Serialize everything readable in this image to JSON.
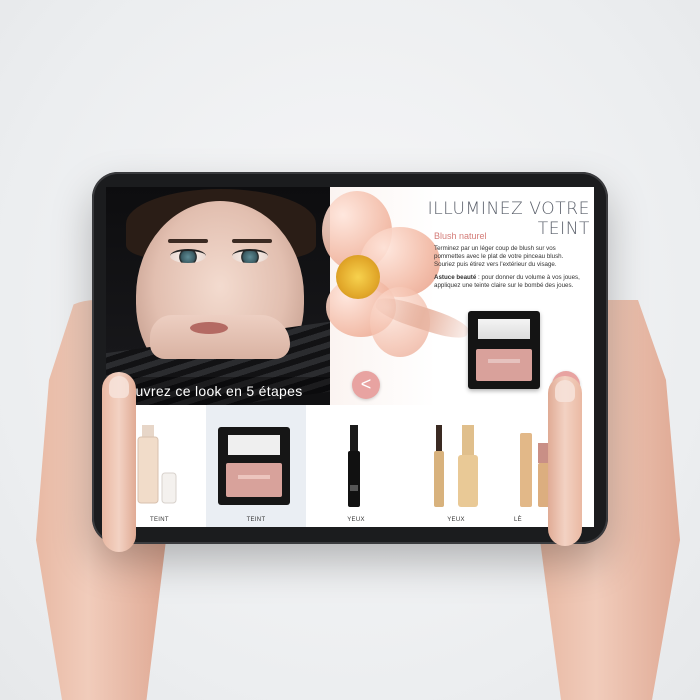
{
  "hero": {
    "caption": "écouvrez ce look en 5 étapes",
    "title": "ILLUMINEZ VOTRE TEINT",
    "subtitle": "Blush naturel",
    "paragraph1": "Terminez par un léger coup de blush sur vos pommettes avec le plat de votre pinceau blush. Souriez puis étirez vers l'extérieur du visage.",
    "tip_label": "Astuce beauté",
    "tip_text": " : pour donner du volume à vos joues, appliquez une teinte claire sur le bombé des joues.",
    "prev_icon": "<"
  },
  "products": [
    {
      "label": "TEINT",
      "icon": "foundation-bottle-icon"
    },
    {
      "label": "TEINT",
      "icon": "blush-compact-icon",
      "active": true
    },
    {
      "label": "YEUX",
      "icon": "eyeliner-icon"
    },
    {
      "label": "YEUX",
      "icon": "mascara-icon"
    },
    {
      "label": "LÈ",
      "icon": "lipstick-icon"
    }
  ],
  "colors": {
    "accent": "#e8a3a1",
    "subtitle": "#d47c78",
    "active_tab_bg": "#eaeef3"
  }
}
